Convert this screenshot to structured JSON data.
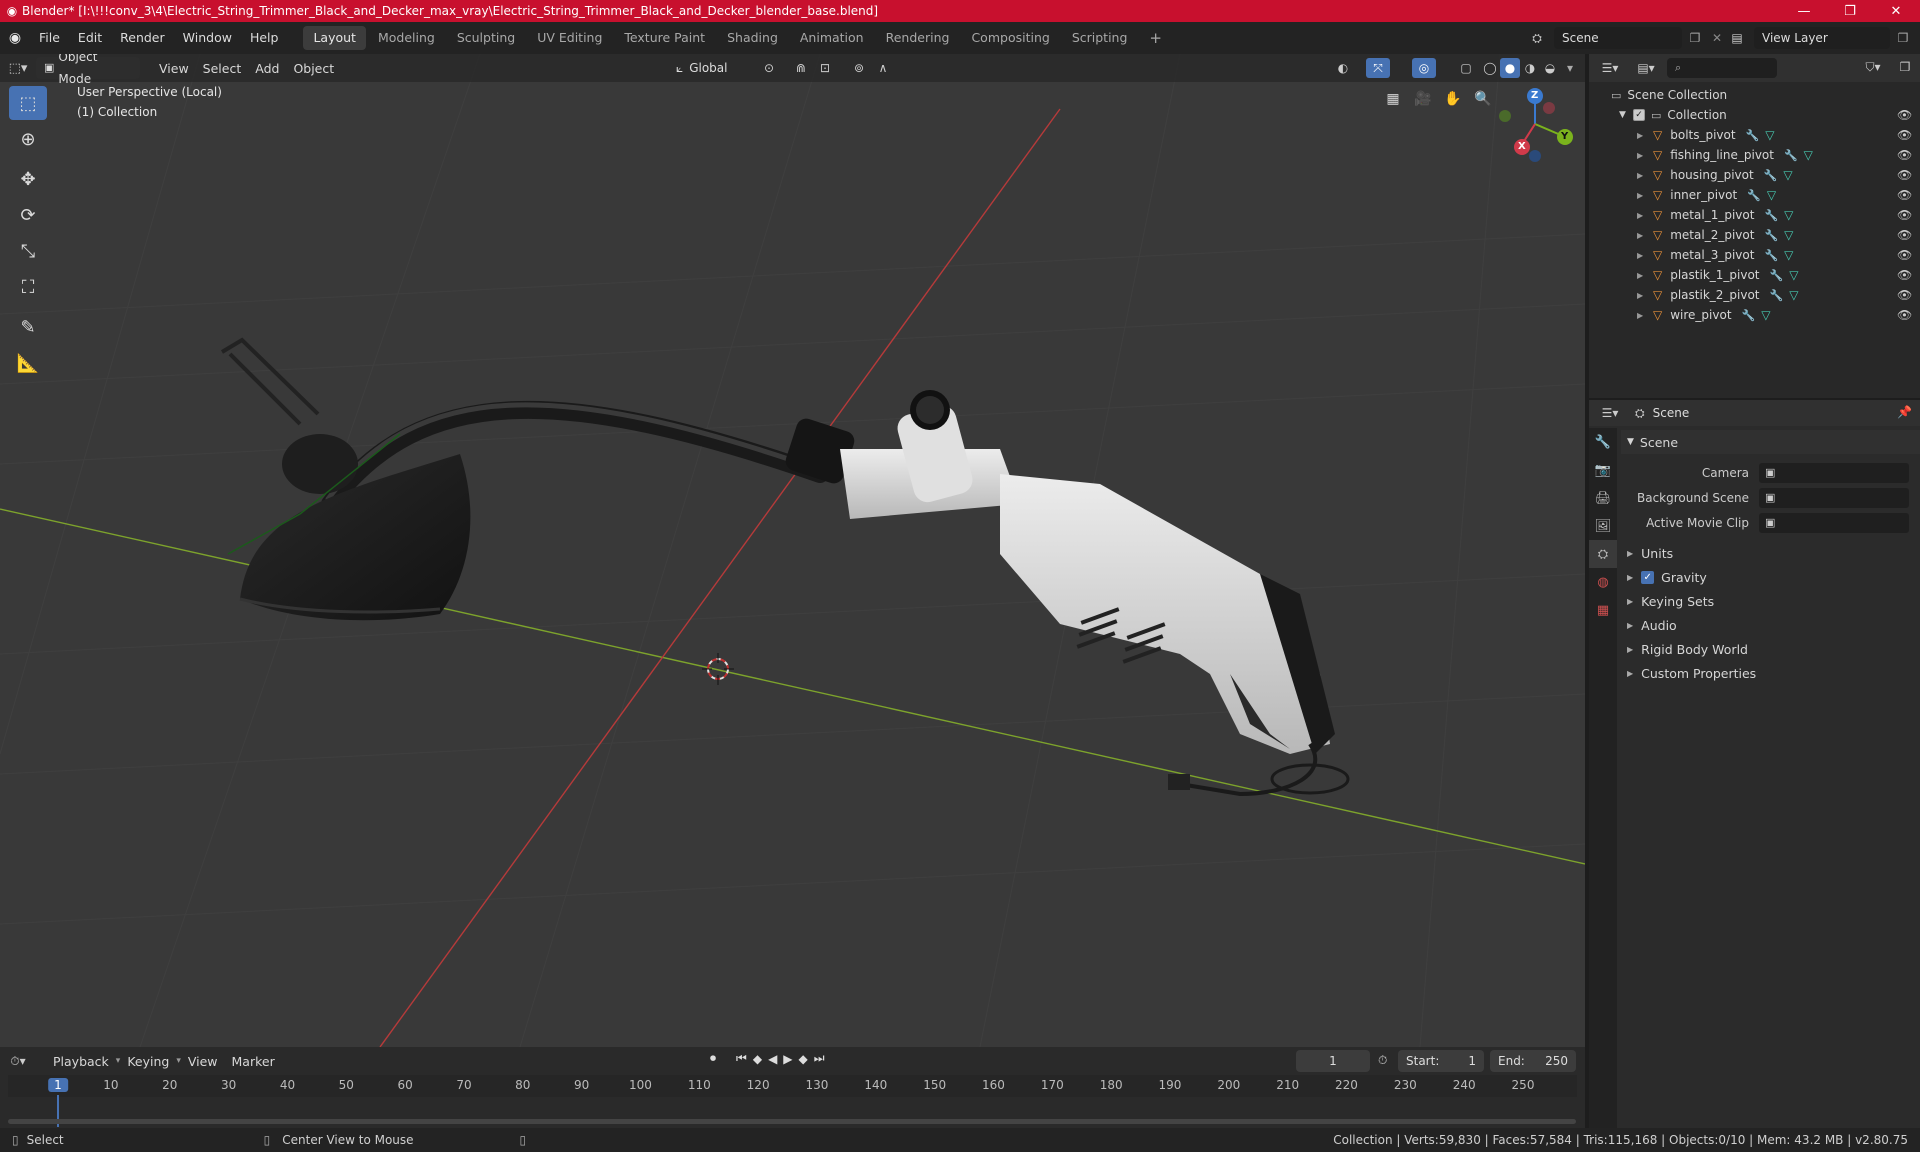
{
  "window": {
    "title": "Blender* [I:\\!!!conv_3\\4\\Electric_String_Trimmer_Black_and_Decker_max_vray\\Electric_String_Trimmer_Black_and_Decker_blender_base.blend]",
    "minimize": "—",
    "maximize": "❐",
    "close": "✕"
  },
  "menubar": {
    "menus": [
      "File",
      "Edit",
      "Render",
      "Window",
      "Help"
    ],
    "workspaces": [
      "Layout",
      "Modeling",
      "Sculpting",
      "UV Editing",
      "Texture Paint",
      "Shading",
      "Animation",
      "Rendering",
      "Compositing",
      "Scripting"
    ],
    "active_workspace": "Layout",
    "add_tab": "+",
    "scene": "Scene",
    "view_layer": "View Layer"
  },
  "viewport_header": {
    "mode": "Object Mode",
    "menus": [
      "View",
      "Select",
      "Add",
      "Object"
    ],
    "orientation": "Global"
  },
  "viewport": {
    "perspective": "User Perspective (Local)",
    "collection": "(1) Collection",
    "gizmo": {
      "z": "Z",
      "y": "Y",
      "x": "X"
    }
  },
  "outliner": {
    "search_placeholder": "",
    "scene_collection": "Scene Collection",
    "collection": "Collection",
    "objects": [
      "bolts_pivot",
      "fishing_line_pivot",
      "housing_pivot",
      "inner_pivot",
      "metal_1_pivot",
      "metal_2_pivot",
      "metal_3_pivot",
      "plastik_1_pivot",
      "plastik_2_pivot",
      "wire_pivot"
    ]
  },
  "properties": {
    "header": "Scene",
    "panel_title": "Scene",
    "fields": [
      {
        "label": "Camera",
        "value": ""
      },
      {
        "label": "Background Scene",
        "value": ""
      },
      {
        "label": "Active Movie Clip",
        "value": ""
      }
    ],
    "sections": [
      "Units",
      "Gravity",
      "Keying Sets",
      "Audio",
      "Rigid Body World",
      "Custom Properties"
    ],
    "gravity_checked": true
  },
  "timeline": {
    "menus": [
      "Playback",
      "Keying",
      "View",
      "Marker"
    ],
    "current_frame": "1",
    "start_label": "Start:",
    "start": "1",
    "end_label": "End:",
    "end": "250",
    "ruler": [
      "1",
      "10",
      "20",
      "30",
      "40",
      "50",
      "60",
      "70",
      "80",
      "90",
      "100",
      "110",
      "120",
      "130",
      "140",
      "150",
      "160",
      "170",
      "180",
      "190",
      "200",
      "210",
      "220",
      "230",
      "240",
      "250"
    ]
  },
  "statusbar": {
    "select": "Select",
    "center": "Center View to Mouse",
    "stats": "Collection | Verts:59,830 | Faces:57,584 | Tris:115,168 | Objects:0/10 | Mem: 43.2 MB | v2.80.75"
  },
  "colors": {
    "accent": "#4772b3",
    "title_bar": "#c8102e",
    "object_icon": "#e8913a",
    "mesh_icon": "#47c8b0",
    "modifier_icon": "#6fa0e8"
  }
}
